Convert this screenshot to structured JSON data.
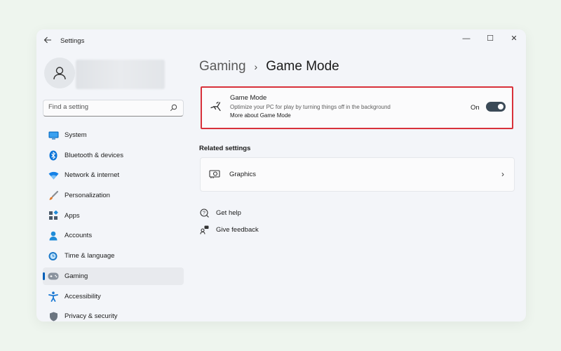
{
  "window": {
    "title": "Settings",
    "controls": {
      "minimize": "—",
      "maximize": "☐",
      "close": "✕"
    },
    "back_icon": "back-arrow-icon"
  },
  "sidebar": {
    "search": {
      "placeholder": "Find a setting",
      "icon": "search-icon"
    },
    "items": [
      {
        "label": "System",
        "icon": "monitor-icon",
        "color": "#0067c0"
      },
      {
        "label": "Bluetooth & devices",
        "icon": "bluetooth-icon",
        "color": "#0a74d8"
      },
      {
        "label": "Network & internet",
        "icon": "wifi-icon",
        "color": "#1581e6"
      },
      {
        "label": "Personalization",
        "icon": "brush-icon",
        "color": "#e07a2c"
      },
      {
        "label": "Apps",
        "icon": "apps-icon",
        "color": "#4a5a6a"
      },
      {
        "label": "Accounts",
        "icon": "person-icon",
        "color": "#1f8bd8"
      },
      {
        "label": "Time & language",
        "icon": "globe-clock-icon",
        "color": "#1b78c8"
      },
      {
        "label": "Gaming",
        "icon": "gamepad-icon",
        "color": "#7d8794",
        "selected": true
      },
      {
        "label": "Accessibility",
        "icon": "accessibility-icon",
        "color": "#1877d3"
      },
      {
        "label": "Privacy & security",
        "icon": "shield-icon",
        "color": "#6b7580"
      }
    ]
  },
  "main": {
    "breadcrumb": {
      "parent": "Gaming",
      "separator": "›",
      "current": "Game Mode"
    },
    "game_mode": {
      "title": "Game Mode",
      "description": "Optimize your PC for play by turning things off in the background",
      "link": "More about Game Mode",
      "state_label": "On",
      "enabled": true,
      "icon": "game-mode-icon",
      "highlight_color": "#d8313a"
    },
    "related": {
      "heading": "Related settings",
      "items": [
        {
          "label": "Graphics",
          "icon": "graphics-card-icon"
        }
      ]
    },
    "help": [
      {
        "label": "Get help",
        "icon": "help-icon"
      },
      {
        "label": "Give feedback",
        "icon": "feedback-icon"
      }
    ]
  },
  "colors": {
    "accent": "#005fb8",
    "toggle_on": "#3b4a57",
    "highlight": "#d8313a"
  }
}
